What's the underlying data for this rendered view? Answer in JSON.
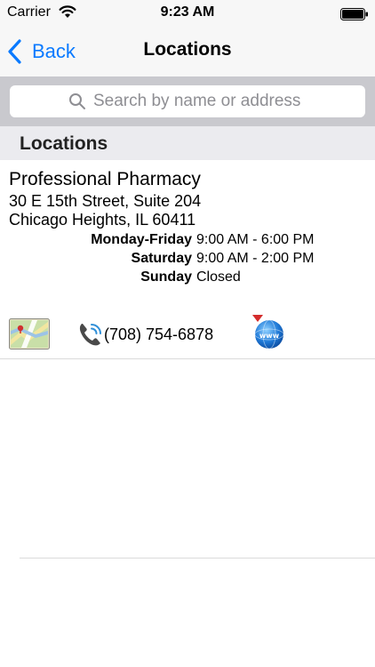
{
  "status_bar": {
    "carrier": "Carrier",
    "time": "9:23 AM"
  },
  "nav_bar": {
    "back_label": "Back",
    "title": "Locations"
  },
  "search": {
    "placeholder": "Search by name or address"
  },
  "section": {
    "title": "Locations"
  },
  "location": {
    "name": "Professional Pharmacy",
    "address_line1": "30 E 15th Street, Suite 204",
    "address_line2": "Chicago Heights, IL 60411",
    "hours": [
      {
        "day": "Monday-Friday",
        "time": "9:00 AM - 6:00 PM"
      },
      {
        "day": "Saturday",
        "time": "9:00 AM - 2:00 PM"
      },
      {
        "day": "Sunday",
        "time": "Closed"
      }
    ],
    "phone": "(708) 754-6878"
  },
  "icons": {
    "map": "map-icon",
    "phone": "phone-icon",
    "web": "web-icon"
  },
  "colors": {
    "accent": "#0a7aff",
    "search_bar_bg": "#c9c9ce",
    "section_bg": "#ebebef"
  }
}
